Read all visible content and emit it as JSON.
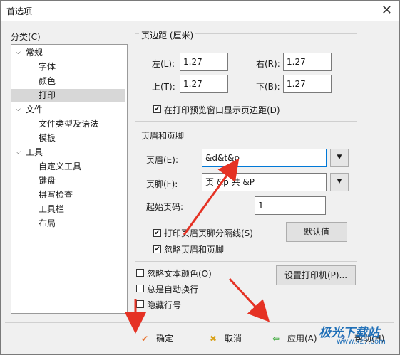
{
  "window": {
    "title": "首选项",
    "close": "✕"
  },
  "categories": {
    "label": "分类(C)",
    "items": [
      {
        "label": "常规",
        "caret": "⌵"
      },
      {
        "label": "字体"
      },
      {
        "label": "颜色"
      },
      {
        "label": "打印",
        "selected": true
      },
      {
        "label": "文件",
        "caret": "⌵"
      },
      {
        "label": "文件类型及语法"
      },
      {
        "label": "模板"
      },
      {
        "label": "工具",
        "caret": "⌵"
      },
      {
        "label": "自定义工具"
      },
      {
        "label": "键盘"
      },
      {
        "label": "拼写检查"
      },
      {
        "label": "工具栏"
      },
      {
        "label": "布局"
      }
    ]
  },
  "margins": {
    "title": "页边距 (厘米)",
    "left_label": "左(L):",
    "left_value": "1.27",
    "right_label": "右(R):",
    "right_value": "1.27",
    "top_label": "上(T):",
    "top_value": "1.27",
    "bottom_label": "下(B):",
    "bottom_value": "1.27",
    "show_margins_label": "在打印预览窗口显示页边距(D)",
    "show_margins_checked": true
  },
  "header_footer": {
    "title": "页眉和页脚",
    "header_label": "页眉(E):",
    "header_value": "&d&t&p",
    "footer_label": "页脚(F):",
    "footer_value": "页 &p 共 &P",
    "start_page_label": "起始页码:",
    "start_page_value": "1",
    "separator_label": "打印页眉页脚分隔线(S)",
    "separator_checked": true,
    "ignore_label": "忽略页眉和页脚",
    "ignore_checked": true,
    "default_button": "默认值",
    "dropdown_glyph": "▼"
  },
  "options": {
    "ignore_color_label": "忽略文本颜色(O)",
    "ignore_color_checked": false,
    "wrap_label": "总是自动换行",
    "wrap_checked": false,
    "hide_lines_label": "隐藏行号",
    "hide_lines_checked": false,
    "printer_button": "设置打印机(P)..."
  },
  "footer": {
    "ok": "确定",
    "cancel": "取消",
    "apply": "应用(A)",
    "help": "帮助(H)",
    "ok_icon": "✔",
    "cancel_icon": "✖",
    "apply_icon": "⇦",
    "help_icon": "?"
  },
  "watermark": {
    "name": "极光下载站",
    "url": "www.xz7.com"
  },
  "colors": {
    "arrow": "#e53224",
    "accent": "#0078d7",
    "ok_icon": "#e8702a",
    "cancel_icon": "#d9a21a",
    "apply_icon": "#3aa838"
  }
}
